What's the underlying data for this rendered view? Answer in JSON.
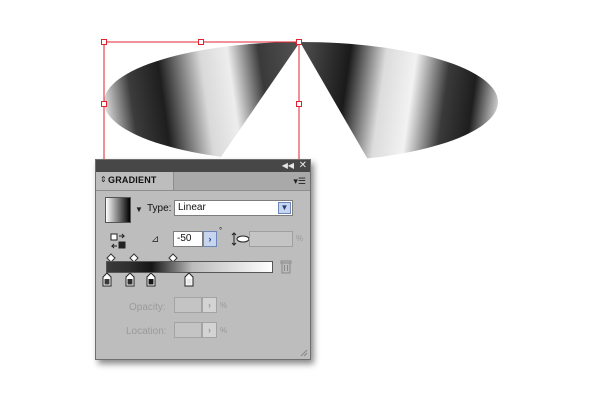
{
  "colors": {
    "selection": "#e0212f",
    "panel_bg": "#bdbdbd",
    "titlebar": "#474747",
    "accent_button": "#c7d6ee"
  },
  "panel": {
    "title": "GRADIENT",
    "collapse_icon": "double-arrow-collapse-icon",
    "close_icon": "close-icon",
    "menu_icon": "panel-menu-icon",
    "type_label": "Type:",
    "type_value": "Linear",
    "angle_value": "-50",
    "degree_symbol": "°",
    "aspect_unit": "%",
    "opacity_label": "Opacity:",
    "opacity_unit": "%",
    "location_label": "Location:",
    "location_unit": "%"
  },
  "gradient": {
    "stops": [
      {
        "position_pct": 0,
        "color": "#3a3a3a"
      },
      {
        "position_pct": 14,
        "color": "#2e2e2e"
      },
      {
        "position_pct": 27,
        "color": "#151515"
      },
      {
        "position_pct": 52,
        "color": "#bdbdbd"
      }
    ],
    "midpoints_pct": [
      7,
      20,
      42
    ]
  }
}
